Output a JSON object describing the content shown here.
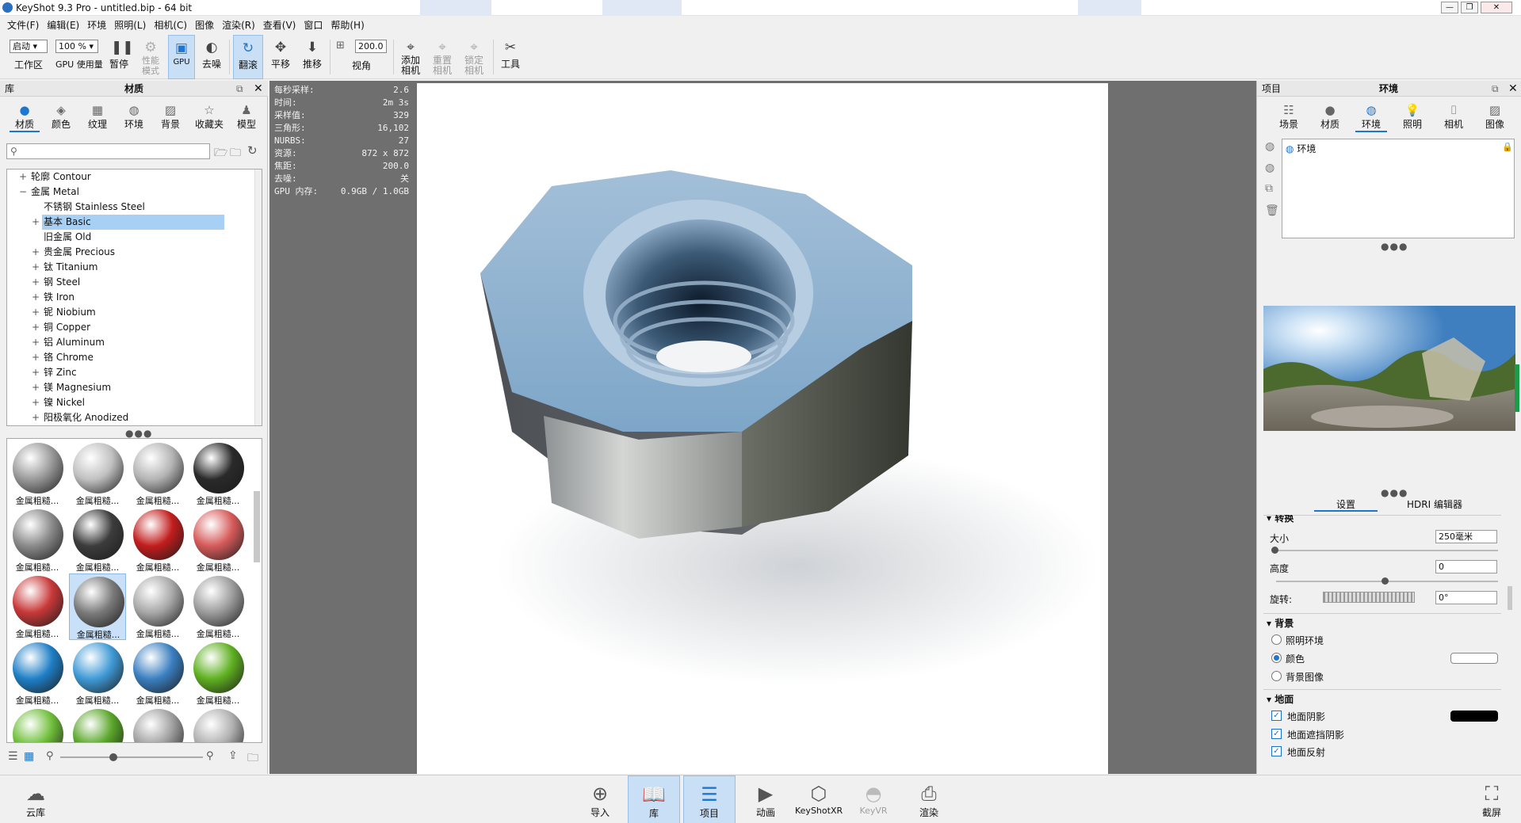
{
  "window": {
    "title": "KeyShot 9.3 Pro  - untitled.bip  - 64 bit",
    "buttons": [
      "—",
      "❐",
      "✕"
    ]
  },
  "menu": [
    "文件(F)",
    "编辑(E)",
    "环境",
    "照明(L)",
    "相机(C)",
    "图像",
    "渲染(R)",
    "查看(V)",
    "窗口",
    "帮助(H)"
  ],
  "toolbar": {
    "workspace_value": "启动",
    "workspace_label": "工作区",
    "gpu_value": "100 %",
    "gpu_label": "GPU 使用量",
    "pause": "暂停",
    "perf_top": "性能",
    "perf_bottom": "模式",
    "gpu": "GPU",
    "denoise": "去噪",
    "tumble": "翻滚",
    "pan": "平移",
    "dolly": "推移",
    "fov_value": "200.0",
    "fov_label": "视角",
    "add_cam_top": "添加",
    "add_cam_bottom": "相机",
    "reset_cam_top": "重置",
    "reset_cam_bottom": "相机",
    "lock_cam_top": "锁定",
    "lock_cam_bottom": "相机",
    "tools": "工具"
  },
  "library": {
    "left_label": "库",
    "title": "材质",
    "tabs": [
      {
        "icon": "material-icon",
        "label": "材质"
      },
      {
        "icon": "color-icon",
        "label": "颜色"
      },
      {
        "icon": "texture-icon",
        "label": "纹理"
      },
      {
        "icon": "environment-icon",
        "label": "环境"
      },
      {
        "icon": "background-icon",
        "label": "背景"
      },
      {
        "icon": "favorites-icon",
        "label": "收藏夹"
      },
      {
        "icon": "model-icon",
        "label": "模型"
      }
    ],
    "search_placeholder": "",
    "tree": [
      {
        "label": "轮廓 Contour",
        "expander": "+",
        "level": 1
      },
      {
        "label": "金属 Metal",
        "expander": "−",
        "level": 1
      },
      {
        "label": "不锈钢 Stainless Steel",
        "expander": "",
        "level": 2
      },
      {
        "label": "基本 Basic",
        "expander": "+",
        "level": 2,
        "selected": true
      },
      {
        "label": "旧金属 Old",
        "expander": "",
        "level": 2
      },
      {
        "label": "贵金属 Precious",
        "expander": "+",
        "level": 2
      },
      {
        "label": "钛 Titanium",
        "expander": "+",
        "level": 2
      },
      {
        "label": "钢 Steel",
        "expander": "+",
        "level": 2
      },
      {
        "label": "铁 Iron",
        "expander": "+",
        "level": 2
      },
      {
        "label": "铌 Niobium",
        "expander": "+",
        "level": 2
      },
      {
        "label": "铜 Copper",
        "expander": "+",
        "level": 2
      },
      {
        "label": "铝 Aluminum",
        "expander": "+",
        "level": 2
      },
      {
        "label": "铬 Chrome",
        "expander": "+",
        "level": 2
      },
      {
        "label": "锌 Zinc",
        "expander": "+",
        "level": 2
      },
      {
        "label": "镁 Magnesium",
        "expander": "+",
        "level": 2
      },
      {
        "label": "镍 Nickel",
        "expander": "+",
        "level": 2
      },
      {
        "label": "阳极氧化 Anodized",
        "expander": "+",
        "level": 2
      }
    ],
    "thumbs": [
      {
        "caption": "金属粗糙...",
        "color": "#9a9a9a"
      },
      {
        "caption": "金属粗糙...",
        "color": "#c0c0c0"
      },
      {
        "caption": "金属粗糙...",
        "color": "#b4b4b4"
      },
      {
        "caption": "金属粗糙...",
        "color": "#2a2a2a"
      },
      {
        "caption": "金属粗糙...",
        "color": "#8a8a8a"
      },
      {
        "caption": "金属粗糙...",
        "color": "#3c3c3c"
      },
      {
        "caption": "金属粗糙...",
        "color": "#c21d1d"
      },
      {
        "caption": "金属粗糙...",
        "color": "#d65a5a"
      },
      {
        "caption": "金属粗糙...",
        "color": "#c83838"
      },
      {
        "caption": "金属粗糙...",
        "color": "#7a7a7a",
        "selected": true
      },
      {
        "caption": "金属粗糙...",
        "color": "#a8a8a8"
      },
      {
        "caption": "金属粗糙...",
        "color": "#9c9c9c"
      },
      {
        "caption": "金属粗糙...",
        "color": "#1f7fc6"
      },
      {
        "caption": "金属粗糙...",
        "color": "#3f9ad6"
      },
      {
        "caption": "金属粗糙...",
        "color": "#3a7fc0"
      },
      {
        "caption": "金属粗糙...",
        "color": "#5eb020"
      },
      {
        "caption": "",
        "color": "#6fbe3a"
      },
      {
        "caption": "",
        "color": "#5aa62a"
      },
      {
        "caption": "",
        "color": "#a0a0a0"
      },
      {
        "caption": "",
        "color": "#b0b0b0"
      }
    ]
  },
  "stats": [
    {
      "k": "每秒采样:",
      "v": "2.6"
    },
    {
      "k": "时间:",
      "v": "2m 3s"
    },
    {
      "k": "采样值:",
      "v": "329"
    },
    {
      "k": "三角形:",
      "v": "16,102"
    },
    {
      "k": "NURBS:",
      "v": "27"
    },
    {
      "k": "资源:",
      "v": "872 x 872"
    },
    {
      "k": "焦距:",
      "v": "200.0"
    },
    {
      "k": "去噪:",
      "v": "关"
    },
    {
      "k": "GPU 内存:",
      "v": "0.9GB / 1.0GB"
    }
  ],
  "project": {
    "left_label": "项目",
    "title": "环境",
    "tabs": [
      {
        "icon": "scene-icon",
        "label": "场景"
      },
      {
        "icon": "material-icon",
        "label": "材质"
      },
      {
        "icon": "environment-icon",
        "label": "环境"
      },
      {
        "icon": "lighting-icon",
        "label": "照明"
      },
      {
        "icon": "camera-icon",
        "label": "相机"
      },
      {
        "icon": "image-icon",
        "label": "图像"
      }
    ],
    "env_item": "环境",
    "subtabs": [
      "设置",
      "HDRI 编辑器"
    ],
    "transform": {
      "header": "转换",
      "size_label": "大小",
      "size_value": "250毫米",
      "height_label": "高度",
      "height_value": "0",
      "rotation_label": "旋转:",
      "rotation_value": "0°"
    },
    "background": {
      "header": "背景",
      "options": [
        "照明环境",
        "颜色",
        "背景图像"
      ],
      "selected": 1
    },
    "ground": {
      "header": "地面",
      "shadow": "地面阴影",
      "occlusion": "地面遮挡阴影",
      "reflection": "地面反射"
    }
  },
  "bottom": {
    "cloud": "云库",
    "buttons": [
      {
        "icon": "import-icon",
        "label": "导入"
      },
      {
        "icon": "library-icon",
        "label": "库"
      },
      {
        "icon": "project-icon",
        "label": "项目"
      },
      {
        "icon": "animation-icon",
        "label": "动画"
      },
      {
        "icon": "keyshotxr-icon",
        "label": "KeyShotXR"
      },
      {
        "icon": "keyvr-icon",
        "label": "KeyVR"
      },
      {
        "icon": "render-icon",
        "label": "渲染"
      }
    ],
    "screenshot": "截屏"
  }
}
